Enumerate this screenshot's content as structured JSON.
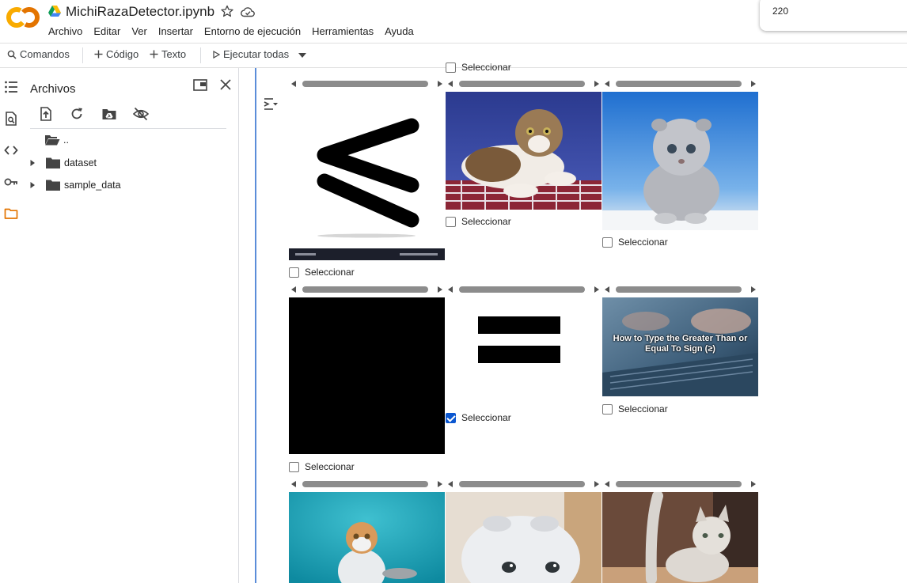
{
  "app": {
    "title": "MichiRazaDetector.ipynb",
    "menu": [
      "Archivo",
      "Editar",
      "Ver",
      "Insertar",
      "Entorno de ejecución",
      "Herramientas",
      "Ayuda"
    ]
  },
  "popup": {
    "value": "220"
  },
  "toolbar": {
    "commands": "Comandos",
    "code": "Código",
    "text": "Texto",
    "run_all": "Ejecutar todas"
  },
  "files": {
    "title": "Archivos",
    "parent": "..",
    "items": [
      "dataset",
      "sample_data"
    ]
  },
  "output": {
    "select_label": "Seleccionar",
    "top_partial_label": "Seleccionar",
    "checked": [
      false,
      false,
      false,
      false,
      true,
      false,
      false,
      false,
      false
    ],
    "watermark_text": "How to Type the Greater Than or Equal To Sign (≥)"
  },
  "colors": {
    "accent": "#0b57d0",
    "cell_bar": "#5b8dd9",
    "logo_orange": "#f9ab00",
    "logo_dark_orange": "#e37400"
  },
  "icons": [
    "colab-logo-icon",
    "drive-icon",
    "star-icon",
    "cloud-icon",
    "search-icon",
    "plus-icon",
    "play-icon",
    "dropdown-icon",
    "toc-icon",
    "find-icon",
    "code-icon",
    "key-icon",
    "folder-icon",
    "new-window-icon",
    "close-icon",
    "upload-icon",
    "refresh-icon",
    "drive-mount-icon",
    "hide-icon"
  ]
}
